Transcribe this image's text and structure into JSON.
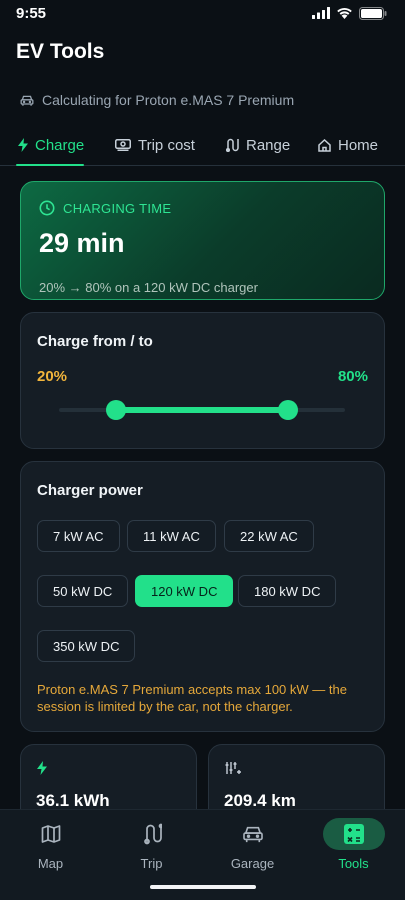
{
  "status_bar": {
    "time": "9:55"
  },
  "app": {
    "title": "EV Tools",
    "subtitle": "Calculating for Proton e.MAS 7 Premium"
  },
  "tabs": [
    {
      "label": "Charge",
      "icon": "bolt-icon",
      "active": true
    },
    {
      "label": "Trip cost",
      "icon": "cash-icon",
      "active": false
    },
    {
      "label": "Range",
      "icon": "route-icon",
      "active": false
    },
    {
      "label": "Home",
      "icon": "home-icon",
      "active": false
    }
  ],
  "charging_time": {
    "label": "CHARGING TIME",
    "value": "29 min",
    "description": "20% → 80% on a 120 kW DC charger"
  },
  "charge_range": {
    "title": "Charge from / to",
    "from_label": "20%",
    "to_label": "80%",
    "from_value": 20,
    "to_value": 80
  },
  "charger_power": {
    "title": "Charger power",
    "options": [
      "7 kW AC",
      "11 kW AC",
      "22 kW AC",
      "50 kW DC",
      "120 kW DC",
      "180 kW DC",
      "350 kW DC"
    ],
    "selected": "120 kW DC",
    "note": "Proton e.MAS 7 Premium accepts max 100 kW — the session is limited by the car, not the charger."
  },
  "stats": [
    {
      "icon": "bolt-icon",
      "value": "36.1 kWh"
    },
    {
      "icon": "sliders-icon",
      "value": "209.4 km"
    }
  ],
  "bottom_nav": [
    {
      "label": "Map",
      "icon": "map-icon",
      "active": false
    },
    {
      "label": "Trip",
      "icon": "route-icon",
      "active": false
    },
    {
      "label": "Garage",
      "icon": "car-icon",
      "active": false
    },
    {
      "label": "Tools",
      "icon": "calculator-icon",
      "active": true
    }
  ],
  "colors": {
    "accent": "#22e08a",
    "warning": "#f0b43c",
    "background": "#0b1015",
    "card": "#151d25"
  }
}
